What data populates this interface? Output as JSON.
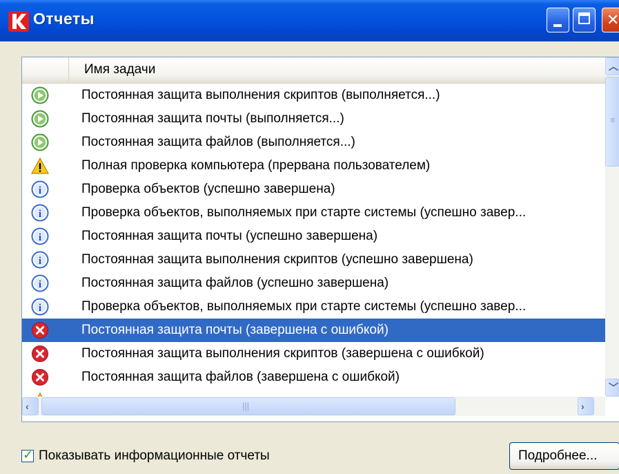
{
  "window": {
    "title": "Отчеты",
    "accent": "#0453df"
  },
  "list": {
    "header": {
      "name_column": "Имя задачи"
    },
    "rows": [
      {
        "icon": "play-icon",
        "text": "Постоянная защита выполнения скриптов (выполняется...)"
      },
      {
        "icon": "play-icon",
        "text": "Постоянная защита почты (выполняется...)"
      },
      {
        "icon": "play-icon",
        "text": "Постоянная защита файлов (выполняется...)"
      },
      {
        "icon": "warning-icon",
        "text": "Полная проверка компьютера (прервана пользователем)"
      },
      {
        "icon": "info-icon",
        "text": "Проверка объектов (успешно завершена)"
      },
      {
        "icon": "info-icon",
        "text": "Проверка объектов, выполняемых при старте системы (успешно завер..."
      },
      {
        "icon": "info-icon",
        "text": "Постоянная защита почты (успешно завершена)"
      },
      {
        "icon": "info-icon",
        "text": "Постоянная защита выполнения скриптов (успешно завершена)"
      },
      {
        "icon": "info-icon",
        "text": "Постоянная защита файлов (успешно завершена)"
      },
      {
        "icon": "info-icon",
        "text": "Проверка объектов, выполняемых при старте системы (успешно завер..."
      },
      {
        "icon": "error-icon",
        "text": "Постоянная защита почты (завершена с ошибкой)",
        "selected": true
      },
      {
        "icon": "error-icon",
        "text": "Постоянная защита выполнения скриптов (завершена с ошибкой)"
      },
      {
        "icon": "error-icon",
        "text": "Постоянная защита файлов (завершена с ошибкой)"
      },
      {
        "icon": "warning-icon",
        "text": ""
      }
    ],
    "selection_color": "#316ac5"
  },
  "footer": {
    "show_info_label": "Показывать информационные отчеты",
    "show_info_checked": true,
    "details_button": "Подробнее..."
  }
}
